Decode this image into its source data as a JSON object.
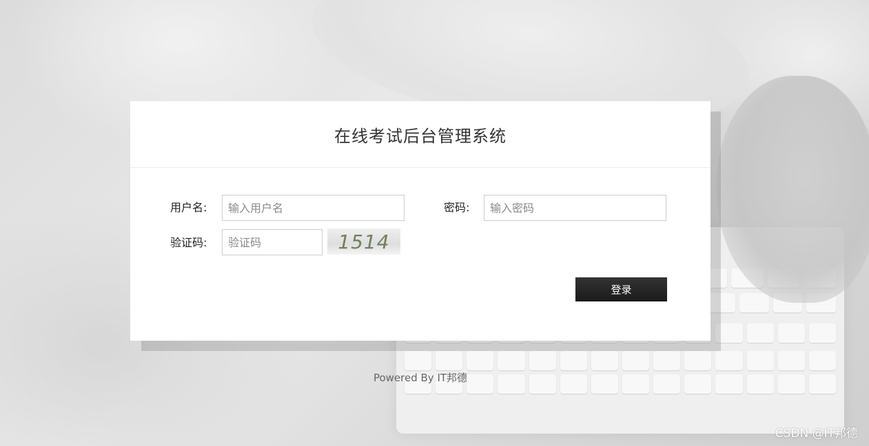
{
  "login": {
    "title": "在线考试后台管理系统",
    "username_label": "用户名:",
    "username_placeholder": "输入用户名",
    "password_label": "密码:",
    "password_placeholder": "输入密码",
    "captcha_label": "验证码:",
    "captcha_placeholder": "验证码",
    "captcha_text": "1514",
    "submit_label": "登录"
  },
  "footer": {
    "powered_by": "Powered By IT邦德"
  },
  "watermark": {
    "text": "CSDN @IT邦德"
  },
  "colors": {
    "button_bg": "#222222",
    "button_text": "#ffffff",
    "captcha_text": "#6f7f5e",
    "panel_bg": "#ffffff"
  }
}
